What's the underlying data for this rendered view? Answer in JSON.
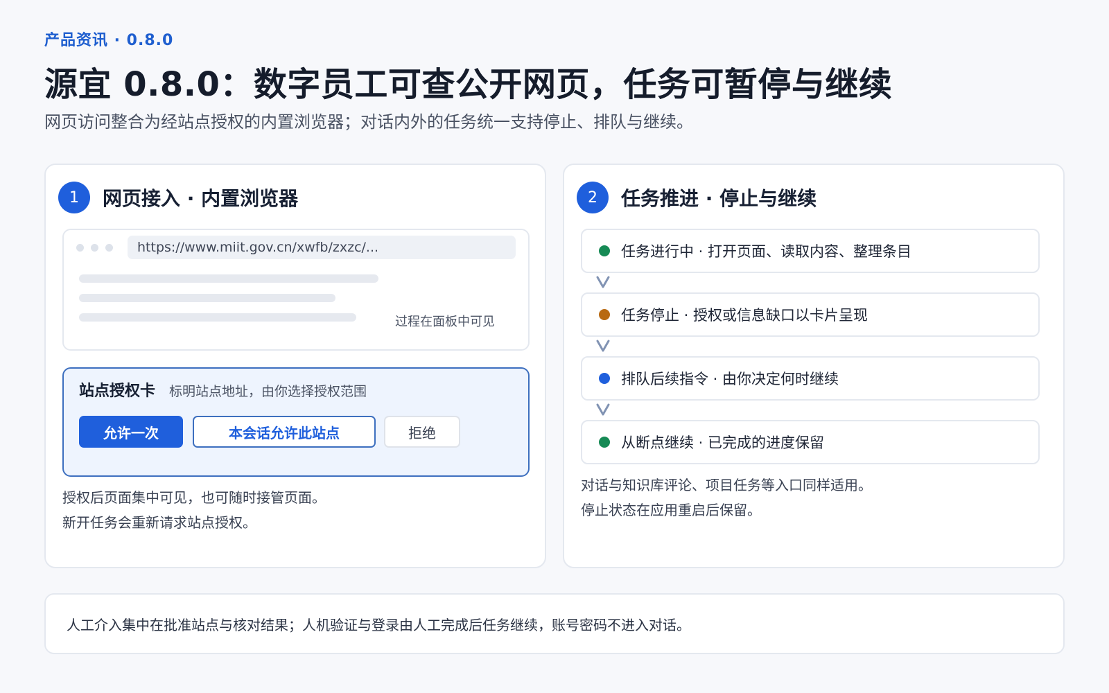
{
  "header": {
    "eyebrow": "产品资讯 · 0.8.0",
    "title": "源宜 0.8.0：数字员工可查公开网页，任务可暂停与继续",
    "subtitle": "网页访问整合为经站点授权的内置浏览器；对话内外的任务统一支持停止、排队与继续。"
  },
  "left_card": {
    "number": "1",
    "title": "网页接入 · 内置浏览器",
    "browser": {
      "url": "https://www.miit.gov.cn/xwfb/zxzc/...",
      "note": "过程在面板中可见"
    },
    "auth": {
      "title": "站点授权卡",
      "description": "标明站点地址，由你选择授权范围",
      "allow_once": "允许一次",
      "allow_session": "本会话允许此站点",
      "deny": "拒绝"
    },
    "footer_lines": [
      "授权后页面集中可见，也可随时接管页面。",
      "新开任务会重新请求站点授权。"
    ]
  },
  "right_card": {
    "number": "2",
    "title": "任务推进 · 停止与继续",
    "steps": [
      {
        "label": "任务进行中 · 打开页面、读取内容、整理条目",
        "color": "#168a55"
      },
      {
        "label": "任务停止 · 授权或信息缺口以卡片呈现",
        "color": "#b86a12"
      },
      {
        "label": "排队后续指令 · 由你决定何时继续",
        "color": "#1f5fdc"
      },
      {
        "label": "从断点继续 · 已完成的进度保留",
        "color": "#168a55"
      }
    ],
    "footer_lines": [
      "对话与知识库评论、项目任务等入口同样适用。",
      "停止状态在应用重启后保留。"
    ]
  },
  "footer": {
    "text": "人工介入集中在批准站点与核对结果；人机验证与登录由人工完成后任务继续，账号密码不进入对话。"
  },
  "colors": {
    "accent": "#1f5fdc",
    "card_border": "#e4e8ef",
    "auth_bg": "#eef4fe"
  }
}
